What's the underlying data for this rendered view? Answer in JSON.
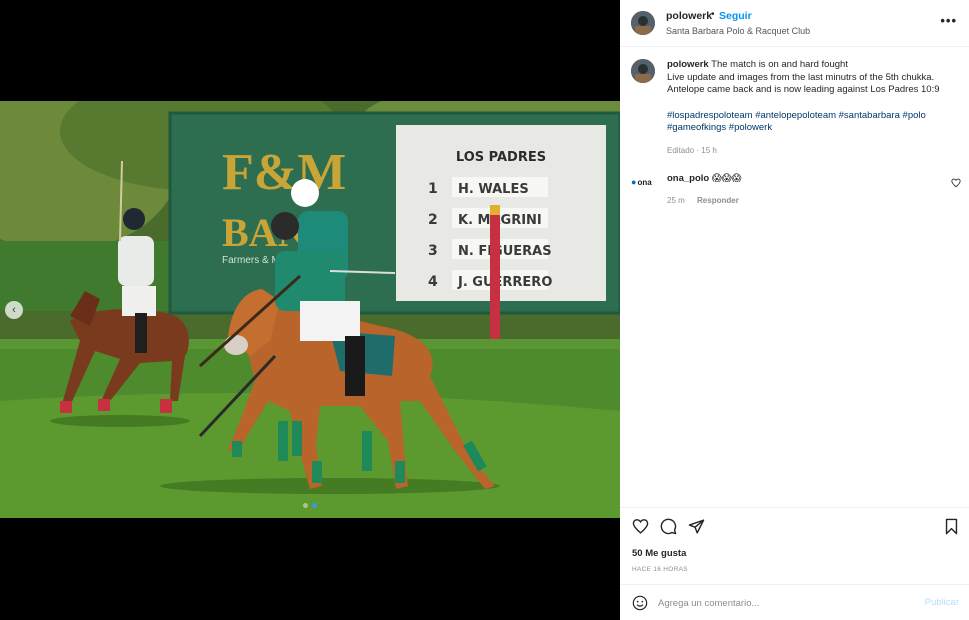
{
  "post": {
    "username": "polowerk",
    "separator": "•",
    "follow_label": "Seguir",
    "location": "Santa Barbara Polo & Racquet Club",
    "more_icon": "more-options-icon"
  },
  "caption": {
    "username": "polowerk",
    "line1": "The match is on and hard fought",
    "line2": "Live update and images from the last minutrs of the 5th chukka.",
    "line3": "Antelope came back and is now leading against Los Padres 10:9",
    "hashtags": "#lospadrespoloteam #antelopepoloteam #santabarbara #polo #gameofkings #polowerk",
    "edited": "Editado · 15 h"
  },
  "comment": {
    "avatar_label": "ona",
    "username": "ona_polo",
    "text": "😱😱😱",
    "time": "25 m",
    "reply_label": "Responder"
  },
  "image": {
    "sign_brand_top": "F&M",
    "sign_brand_bottom": "BANK",
    "sign_sub": "Farmers & Merchants",
    "board_title": "LOS PADRES",
    "board_rows": [
      {
        "num": "1",
        "name": "H. WALES"
      },
      {
        "num": "2",
        "name": "K. MAGRINI"
      },
      {
        "num": "3",
        "name": "N. FIGUERAS"
      },
      {
        "num": "4",
        "name": "J. GUERRERO"
      }
    ],
    "carousel_active_index": 1,
    "carousel_count": 2
  },
  "actions": {
    "likes": "50 Me gusta",
    "when": "HACE 16 HORAS"
  },
  "add_comment": {
    "placeholder": "Agrega un comentario...",
    "post_label": "Publicar"
  },
  "colors": {
    "accent_blue": "#0095f6",
    "hashtag": "#00376b",
    "publish_disabled": "#b2dffc"
  }
}
